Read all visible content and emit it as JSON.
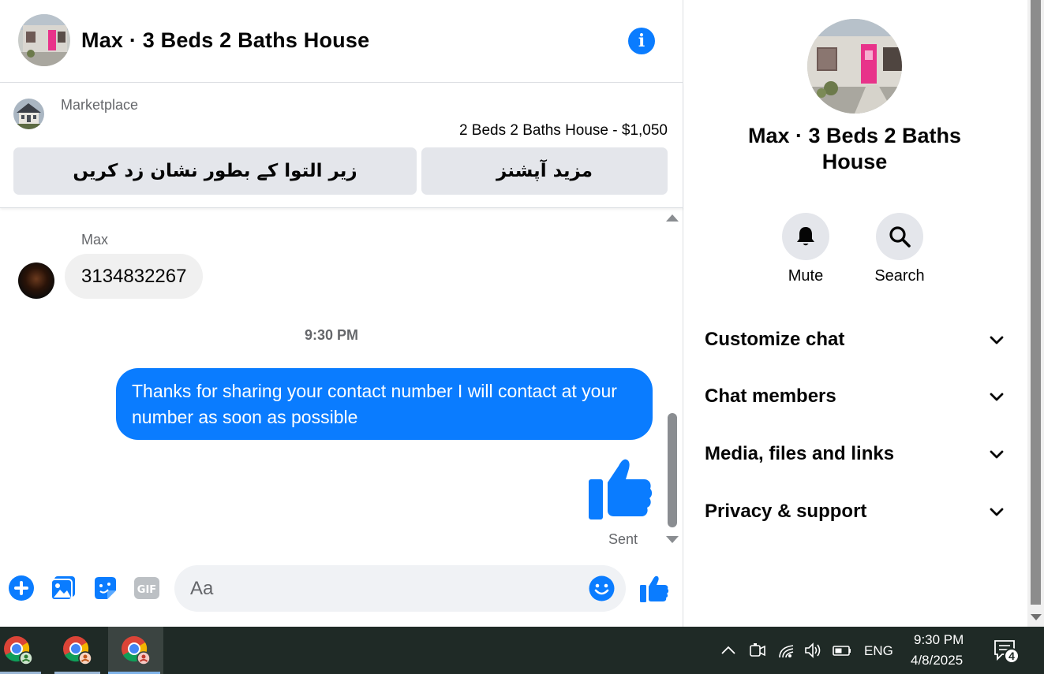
{
  "header": {
    "title": "Max · 3 Beds 2 Baths House",
    "info_icon": "info-icon",
    "accent_color": "#0a7cff"
  },
  "marketplace": {
    "label": "Marketplace",
    "listing": "2 Beds 2 Baths House - $1,050",
    "mark_pending_label": "زیر التوا کے بطور نشان زد کریں",
    "more_options_label": "مزید آپشنز"
  },
  "messages": {
    "sender_name": "Max",
    "incoming_text": "3134832267",
    "timestamp": "9:30 PM",
    "outgoing_text": "Thanks for sharing your contact number I will contact at your number as soon as possible",
    "status": "Sent",
    "incoming_bubble_color": "#f0f0f0",
    "outgoing_bubble_color": "#0a7cff"
  },
  "composer": {
    "placeholder": "Aa",
    "icons": [
      "plus-icon",
      "photo-icon",
      "sticker-icon",
      "gif-icon",
      "emoji-icon",
      "thumbs-up-icon"
    ]
  },
  "panel": {
    "title": "Max · 3 Beds 2 Baths House",
    "actions": [
      {
        "label": "Mute",
        "icon": "bell-icon"
      },
      {
        "label": "Search",
        "icon": "search-icon"
      }
    ],
    "sections": [
      {
        "label": "Customize chat"
      },
      {
        "label": "Chat members"
      },
      {
        "label": "Media, files and links"
      },
      {
        "label": "Privacy & support"
      }
    ]
  },
  "taskbar": {
    "apps": [
      "chrome-icon",
      "chrome-icon",
      "chrome-icon"
    ],
    "language": "ENG",
    "time": "9:30 PM",
    "date": "4/8/2025",
    "notification_count": "4"
  }
}
